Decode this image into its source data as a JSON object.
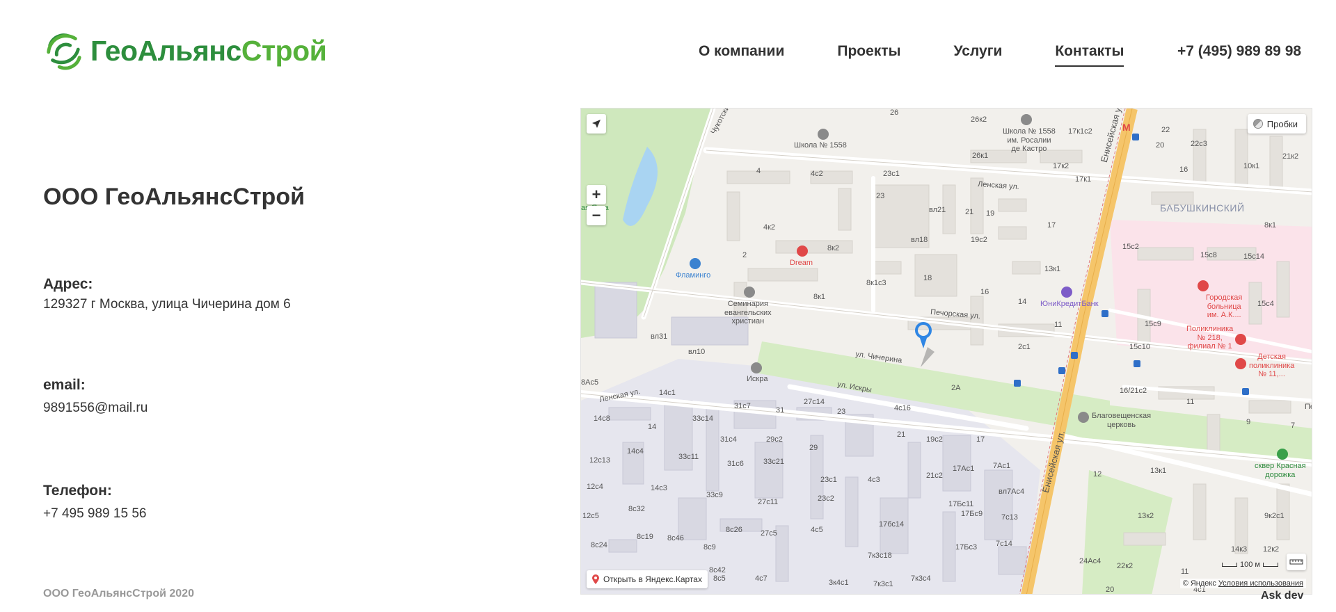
{
  "header": {
    "logo_text_1": "ГеоАльянс",
    "logo_text_2": "Строй",
    "nav": [
      {
        "label": "О компании",
        "active": false
      },
      {
        "label": "Проекты",
        "active": false
      },
      {
        "label": "Услуги",
        "active": false
      },
      {
        "label": "Контакты",
        "active": true
      }
    ],
    "phone": "+7 (495) 989 89 98"
  },
  "contacts": {
    "company_name": "ООО ГеоАльянсСтрой",
    "address_label": "Адрес:",
    "address_value": "129327 г Москва, улица Чичерина дом 6",
    "email_label": "email:",
    "email_value": "9891556@mail.ru",
    "phone_label": "Телефон:",
    "phone_value": "+7 495 989 15 56"
  },
  "footer": {
    "copyright": "ООО ГеоАльянсСтрой 2020",
    "ask_dev": "Ask dev"
  },
  "map": {
    "traffic_label": "Пробки",
    "open_label": "Открыть в Яндекс.Картах",
    "scale_label": "100 м",
    "copyright_prefix": "© Яндекс",
    "terms_label": "Условия использования",
    "zoom_in": "+",
    "zoom_out": "−",
    "labels": {
      "school": "Школа № 1558",
      "school2_l1": "Школа № 1558",
      "school2_l2": "им. Росалии",
      "school2_l3": "де Кастро",
      "lenskaya1": "Ленская ул.",
      "lenskaya2": "Ленская ул.",
      "chukotsky": "Чукотский пр-д",
      "yeniseyskaya1": "Енисейская ул.",
      "yeniseyskaya2": "Енисейская ул.",
      "babushkinsky": "БАБУШКИНСКИЙ",
      "dream": "Dream",
      "flamingo": "Фламинго",
      "seminary_l1": "Семинария",
      "seminary_l2": "евангельских",
      "seminary_l3": "христиан",
      "pechorskaya": "Печорская ул.",
      "chicherina": "ул. Чичерина",
      "iskry": "ул. Искры",
      "iskra": "Искра",
      "unicredit": "ЮниКредитБанк",
      "hospital_l1": "Городская",
      "hospital_l2": "больница",
      "hospital_l3": "им. А.К....",
      "polyclinic_l1": "Поликлиника",
      "polyclinic_l2": "№ 218,",
      "polyclinic_l3": "филиал № 1",
      "kids_l1": "Детская",
      "kids_l2": "поликлиника",
      "kids_l3": "№ 11,...",
      "church_l1": "Благовещенская",
      "church_l2": "церковь",
      "square_l1": "сквер Красная",
      "square_l2": "дорожка",
      "vlyaza": "ая Яуза",
      "pe": "Пе",
      "house_4c2": "4с2",
      "house_23c1": "23с1",
      "house_23": "23",
      "house_4k2": "4к2",
      "house_8k2": "8к2",
      "house_8k1": "8к1",
      "house_8k1c3": "8к1с3",
      "house_vl21": "вл21",
      "house_21": "21",
      "house_19": "19",
      "house_vl18": "вл18",
      "house_19c2": "19с2",
      "house_18": "18",
      "house_16": "16",
      "house_14": "14",
      "house_13k1": "13к1",
      "house_17": "17",
      "house_17k2": "17к2",
      "house_17k1": "17к1",
      "house_17k1c2": "17к1с2",
      "house_26k1": "26к1",
      "house_26k2": "26к2",
      "house_22": "22",
      "house_22c3": "22с3",
      "house_20": "20",
      "house_16b": "16",
      "house_10k1": "10к1",
      "house_21k2": "21к2",
      "house_8k1b": "8к1",
      "house_15c2": "15с2",
      "house_15c8": "15с8",
      "house_15c14": "15с14",
      "house_15c4": "15с4",
      "house_15c9": "15с9",
      "house_15c10": "15с10",
      "house_16_21c2": "16/21с2",
      "house_11": "11",
      "house_11b": "11",
      "house_2c1": "2с1",
      "house_2a": "2А",
      "house_2": "2",
      "house_4": "4",
      "house_vl31": "вл31",
      "house_vl10": "вл10",
      "house_8ac5": "8Ас5",
      "house_14c1": "14с1",
      "house_14c8": "14с8",
      "house_14c4": "14с4",
      "house_12c13": "12с13",
      "house_12c4": "12с4",
      "house_12c5": "12с5",
      "house_8c24": "8с24",
      "house_8c19": "8с19",
      "house_8c46": "8с46",
      "house_8c9": "8с9",
      "house_8c32": "8с32",
      "house_8c42": "8с42",
      "house_8c5": "8с5",
      "house_14c3": "14с3",
      "house_33c14": "33с14",
      "house_33c11": "33с11",
      "house_33c9": "33с9",
      "house_31c7": "31с7",
      "house_31c4": "31с4",
      "house_31c6": "31с6",
      "house_31": "31",
      "house_27c14": "27с14",
      "house_29c2": "29с2",
      "house_33c21": "33с21",
      "house_29": "29",
      "house_27c11": "27с11",
      "house_27c5": "27с5",
      "house_8c26": "8с26",
      "house_23b": "23",
      "house_23c1b": "23с1",
      "house_23c2": "23с2",
      "house_4c5": "4с5",
      "house_4c16": "4с16",
      "house_21b": "21",
      "house_21c2": "21с2",
      "house_19c2b": "19с2",
      "house_17b": "17",
      "house_17ac1": "17Ас1",
      "house_7ac1": "7Ас1",
      "house_17bc11": "17Бс11",
      "house_17bc9": "17Бс9",
      "house_vl7ac4": "вл7Ас4",
      "house_7c13": "7с13",
      "house_17bc3": "17Бс3",
      "house_7c14": "7с14",
      "house_17bc14": "17бс14",
      "house_7k3c18": "7к3с18",
      "house_7k3c4": "7к3с4",
      "house_4c3": "4с3",
      "house_4c7": "4с7",
      "house_3k4c1": "3к4с1",
      "house_7k3c1": "7к3с1",
      "house_26": "26",
      "house_12": "12",
      "house_13k1b": "13к1",
      "house_13k2": "13к2",
      "house_14k3": "14к3",
      "house_12k2": "12к2",
      "house_9k2c1": "9к2с1",
      "house_9": "9",
      "house_7": "7",
      "house_24ac4": "24Ас4",
      "house_22k2": "22к2",
      "house_20b": "20",
      "house_11c": "11",
      "house_4c1": "4с1",
      "house_26top": "26"
    }
  }
}
